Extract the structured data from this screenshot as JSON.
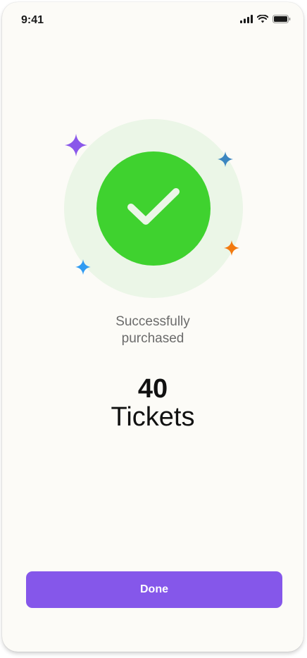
{
  "status_bar": {
    "time": "9:41",
    "icons": [
      "signal-icon",
      "wifi-icon",
      "battery-icon"
    ]
  },
  "illustration": {
    "icon": "checkmark-icon",
    "halo_color": "#ebf6e7",
    "circle_color": "#3fd22f",
    "sparkles": [
      {
        "name": "sparkle-purple-icon",
        "color": "#8a58ea"
      },
      {
        "name": "sparkle-steelblue-icon",
        "color": "#3b86c0"
      },
      {
        "name": "sparkle-orange-icon",
        "color": "#f27a10"
      },
      {
        "name": "sparkle-blue-icon",
        "color": "#2f9bf2"
      }
    ]
  },
  "message": {
    "line1": "Successfully",
    "line2": "purchased"
  },
  "purchase": {
    "count": "40",
    "unit": "Tickets"
  },
  "actions": {
    "done_label": "Done",
    "button_color": "#8557ea"
  }
}
